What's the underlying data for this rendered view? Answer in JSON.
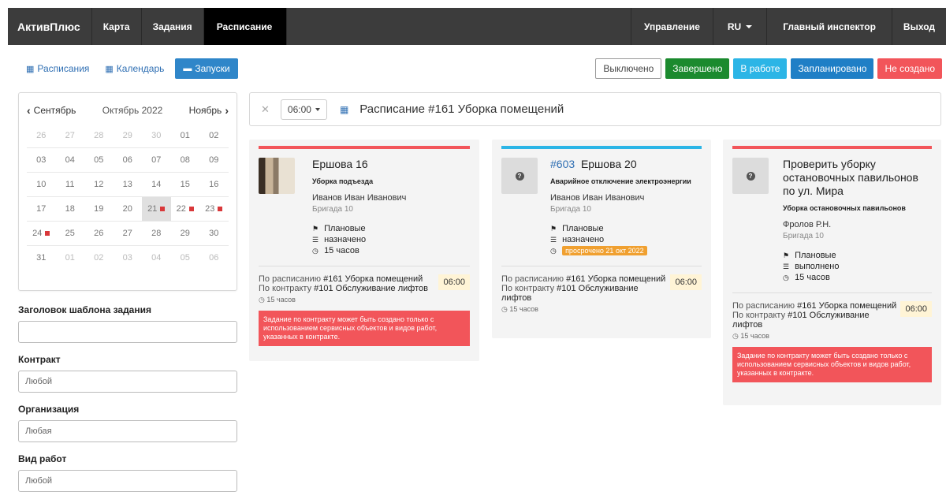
{
  "nav": {
    "brand": "АктивПлюс",
    "items": [
      "Карта",
      "Задания",
      "Расписание"
    ],
    "right": [
      "Управление",
      "RU",
      "Главный инспектор",
      "Выход"
    ]
  },
  "view_tabs": [
    "Расписания",
    "Календарь",
    "Запуски"
  ],
  "status_filters": [
    "Выключено",
    "Завершено",
    "В работе",
    "Запланировано",
    "Не создано"
  ],
  "calendar": {
    "prev": "Сентябрь",
    "current": "Октябрь 2022",
    "next": "Ноябрь",
    "weeks": [
      [
        "26",
        "27",
        "28",
        "29",
        "30",
        "01",
        "02"
      ],
      [
        "03",
        "04",
        "05",
        "06",
        "07",
        "08",
        "09"
      ],
      [
        "10",
        "11",
        "12",
        "13",
        "14",
        "15",
        "16"
      ],
      [
        "17",
        "18",
        "19",
        "20",
        "21",
        "22",
        "23"
      ],
      [
        "24",
        "25",
        "26",
        "27",
        "28",
        "29",
        "30"
      ],
      [
        "31",
        "01",
        "02",
        "03",
        "04",
        "05",
        "06"
      ]
    ]
  },
  "form": {
    "template_title_label": "Заголовок шаблона задания",
    "template_title_value": "",
    "contract_label": "Контракт",
    "contract_value": "Любой",
    "org_label": "Организация",
    "org_value": "Любая",
    "work_type_label": "Вид работ",
    "work_type_value": "Любой"
  },
  "schedule": {
    "time": "06:00",
    "title": "Расписание #161 Уборка помещений"
  },
  "cards": [
    {
      "number": "",
      "title": "Ершова 16",
      "subtitle": "Уборка подъезда",
      "person": "Иванов Иван Иванович",
      "team": "Бригада 10",
      "flag": "Плановые",
      "state": "назначено",
      "duration": "15 часов",
      "late": "",
      "sched_prefix": "По расписанию",
      "sched_name": "#161 Уборка помещений",
      "contract_prefix": "По контракту",
      "contract_name": "#101 Обслуживание лифтов",
      "time": "06:00",
      "dur_small": "15 часов",
      "warning": "Задание по контракту может быть создано только с использованием сервисных объектов и видов работ, указанных в контракте."
    },
    {
      "number": "#603",
      "title": "Ершова 20",
      "subtitle": "Аварийное отключение электроэнергии",
      "person": "Иванов Иван Иванович",
      "team": "Бригада 10",
      "flag": "Плановые",
      "state": "назначено",
      "duration": "",
      "late": "просрочено 21 окт 2022",
      "sched_prefix": "По расписанию",
      "sched_name": "#161 Уборка помещений",
      "contract_prefix": "По контракту",
      "contract_name": "#101 Обслуживание лифтов",
      "time": "06:00",
      "dur_small": "15 часов",
      "warning": ""
    },
    {
      "number": "",
      "title": "Проверить уборку остановочных павильонов по ул. Мира",
      "subtitle": "Уборка остановочных павильонов",
      "person": "Фролов Р.Н.",
      "team": "Бригада 10",
      "flag": "Плановые",
      "state": "выполнено",
      "duration": "15 часов",
      "late": "",
      "sched_prefix": "По расписанию",
      "sched_name": "#161 Уборка помещений",
      "contract_prefix": "По контракту",
      "contract_name": "#101 Обслуживание лифтов",
      "time": "06:00",
      "dur_small": "15 часов",
      "warning": "Задание по контракту может быть создано только с использованием сервисных объектов и видов работ, указанных в контракте."
    }
  ],
  "colors": {
    "navbar": "#3c3c3c",
    "accent_blue": "#2f86c9",
    "status_red": "#f2555a",
    "status_cyan": "#2cb5e6",
    "status_green": "#1b8a2e",
    "marker_red": "#d9383a"
  }
}
